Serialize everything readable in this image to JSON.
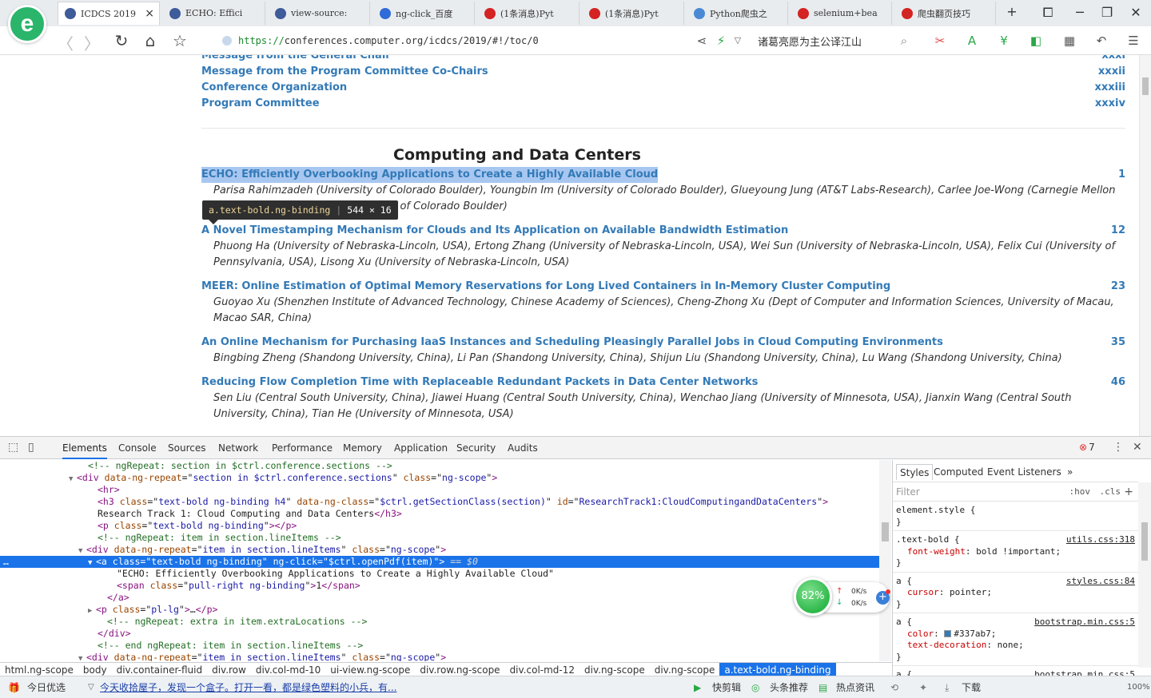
{
  "browser": {
    "tabs": [
      {
        "label": "ICDCS 2019",
        "icon_color": "#3e5b9a",
        "active": true
      },
      {
        "label": "ECHO: Effici",
        "icon_color": "#3e5b9a",
        "active": false
      },
      {
        "label": "view-source:",
        "icon_color": "#3e5b9a",
        "active": false
      },
      {
        "label": "ng-click_百度",
        "icon_color": "#2f6bd8",
        "active": false
      },
      {
        "label": "(1条消息)Pyt",
        "icon_color": "#d42323",
        "active": false
      },
      {
        "label": "(1条消息)Pyt",
        "icon_color": "#d42323",
        "active": false
      },
      {
        "label": "Python爬虫之",
        "icon_color": "#4a8ad4",
        "active": false
      },
      {
        "label": "selenium+bea",
        "icon_color": "#d42323",
        "active": false
      },
      {
        "label": "爬虫翻页技巧",
        "icon_color": "#d42323",
        "active": false
      }
    ],
    "tab_close_glyph": "×",
    "new_tab_glyph": "+",
    "url_scheme": "https://",
    "url_rest": "conferences.computer.org/icdcs/2019/#!/toc/0",
    "search_text": "诸葛亮愿为主公译江山",
    "logo_letter": "e"
  },
  "page": {
    "front_matter": [
      {
        "title": "Message from the General Chair",
        "page": "xxxi"
      },
      {
        "title": "Message from the Program Committee Co-Chairs",
        "page": "xxxii"
      },
      {
        "title": "Conference Organization",
        "page": "xxxiii"
      },
      {
        "title": "Program Committee",
        "page": "xxxiv"
      }
    ],
    "section_title": "Computing and Data Centers",
    "tooltip_class": "a.text-bold.ng-binding",
    "tooltip_size": "544 × 16",
    "papers": [
      {
        "title": "ECHO: Efficiently Overbooking Applications to Create a Highly Available Cloud",
        "page": "1",
        "authors": "Parisa Rahimzadeh (University of Colorado Boulder), Youngbin Im (University of Colorado Boulder), Glueyoung Jung (AT&T Labs-Research), Carlee Joe-Wong (Carnegie Mellon University), Sangtae Ha (University of Colorado Boulder)"
      },
      {
        "title": "A Novel Timestamping Mechanism for Clouds and Its Application on Available Bandwidth Estimation",
        "page": "12",
        "authors": "Phuong Ha (University of Nebraska-Lincoln, USA), Ertong Zhang (University of Nebraska-Lincoln, USA), Wei Sun (University of Nebraska-Lincoln, USA), Felix Cui (University of Pennsylvania, USA), Lisong Xu (University of Nebraska-Lincoln, USA)"
      },
      {
        "title": "MEER: Online Estimation of Optimal Memory Reservations for Long Lived Containers in In-Memory Cluster Computing",
        "page": "23",
        "authors": "Guoyao Xu (Shenzhen Institute of Advanced Technology, Chinese Academy of Sciences), Cheng-Zhong Xu (Dept of Computer and Information Sciences, University of Macau, Macao SAR, China)"
      },
      {
        "title": "An Online Mechanism for Purchasing IaaS Instances and Scheduling Pleasingly Parallel Jobs in Cloud Computing Environments",
        "page": "35",
        "authors": "Bingbing Zheng (Shandong University, China), Li Pan (Shandong University, China), Shijun Liu (Shandong University, China), Lu Wang (Shandong University, China)"
      },
      {
        "title": "Reducing Flow Completion Time with Replaceable Redundant Packets in Data Center Networks",
        "page": "46",
        "authors": "Sen Liu (Central South University, China), Jiawei Huang (Central South University, China), Wenchao Jiang (University of Minnesota, USA), Jianxin Wang (Central South University, China), Tian He (University of Minnesota, USA)"
      }
    ]
  },
  "devtools": {
    "tabs": [
      "Elements",
      "Console",
      "Sources",
      "Network",
      "Performance",
      "Memory",
      "Application",
      "Security",
      "Audits"
    ],
    "error_count": "7",
    "dom_lines": [
      {
        "indent": 110,
        "html": "<span class='cm'>&lt;!-- ngRepeat: section in $ctrl.conference.sections --&gt;</span>"
      },
      {
        "indent": 98,
        "tri": "▼",
        "html": "<span class='tg'>&lt;div</span> <span class='at'>data-ng-repeat</span>=\"<span class='av'>section in $ctrl.conference.sections</span>\" <span class='at'>class</span>=\"<span class='av'>ng-scope</span>\"<span class='tg'>&gt;</span>"
      },
      {
        "indent": 122,
        "html": "<span class='tg'>&lt;hr&gt;</span>"
      },
      {
        "indent": 122,
        "html": "<span class='tg'>&lt;h3</span> <span class='at'>class</span>=\"<span class='av'>text-bold ng-binding h4</span>\" <span class='at'>data-ng-class</span>=\"<span class='av'>$ctrl.getSectionClass(section)</span>\" <span class='at'>id</span>=\"<span class='av'>ResearchTrack1:CloudComputingandDataCenters</span>\"<span class='tg'>&gt;</span>"
      },
      {
        "indent": 122,
        "html": "Research Track 1: Cloud Computing and Data Centers<span class='tg'>&lt;/h3&gt;</span>"
      },
      {
        "indent": 122,
        "html": "<span class='tg'>&lt;p</span> <span class='at'>class</span>=\"<span class='av'>text-bold ng-binding</span>\"<span class='tg'>&gt;&lt;/p&gt;</span>"
      },
      {
        "indent": 122,
        "html": "<span class='cm'>&lt;!-- ngRepeat: item in section.lineItems --&gt;</span>"
      },
      {
        "indent": 110,
        "tri": "▼",
        "html": "<span class='tg'>&lt;div</span> <span class='at'>data-ng-repeat</span>=\"<span class='av'>item in section.lineItems</span>\" <span class='at'>class</span>=\"<span class='av'>ng-scope</span>\"<span class='tg'>&gt;</span>"
      },
      {
        "indent": 122,
        "tri": "▼",
        "sel": true,
        "html": "<span class='tg'>&lt;a</span> <span class='at'>class</span>=\"<span class='av'>text-bold ng-binding</span>\" <span class='at'>ng-click</span>=\"<span class='av'>$ctrl.openPdf(item)</span>\"<span class='tg'>&gt;</span> <span class='eq'>== $0</span>"
      },
      {
        "indent": 146,
        "html": "\"ECHO: Efficiently Overbooking Applications to Create a Highly Available Cloud\""
      },
      {
        "indent": 146,
        "html": "<span class='tg'>&lt;span</span> <span class='at'>class</span>=\"<span class='av'>pull-right ng-binding</span>\"<span class='tg'>&gt;</span>1<span class='tg'>&lt;/span&gt;</span>"
      },
      {
        "indent": 134,
        "html": "<span class='tg'>&lt;/a&gt;</span>"
      },
      {
        "indent": 122,
        "tri": "▶",
        "html": "<span class='tg'>&lt;p</span> <span class='at'>class</span>=\"<span class='av'>pl-lg</span>\"<span class='tg'>&gt;</span>…<span class='tg'>&lt;/p&gt;</span>"
      },
      {
        "indent": 134,
        "html": "<span class='cm'>&lt;!-- ngRepeat: extra in item.extraLocations --&gt;</span>"
      },
      {
        "indent": 122,
        "html": "<span class='tg'>&lt;/div&gt;</span>"
      },
      {
        "indent": 122,
        "html": "<span class='cm'>&lt;!-- end ngRepeat: item in section.lineItems --&gt;</span>"
      },
      {
        "indent": 110,
        "tri": "▼",
        "html": "<span class='tg'>&lt;div</span> <span class='at'>data-ng-repeat</span>=\"<span class='av'>item in section.lineItems</span>\" <span class='at'>class</span>=\"<span class='av'>ng-scope</span>\"<span class='tg'>&gt;</span>"
      }
    ],
    "styles_tabs": [
      "Styles",
      "Computed",
      "Event Listeners"
    ],
    "filter_placeholder": "Filter",
    "hov_label": ":hov",
    "cls_label": ".cls",
    "rules": [
      {
        "selector": "element.style {",
        "source": "",
        "props": []
      },
      {
        "selector": ".text-bold {",
        "source": "utils.css:318",
        "props": [
          {
            "name": "font-weight",
            "value": "bold !important;"
          }
        ]
      },
      {
        "selector": "a {",
        "source": "styles.css:84",
        "props": [
          {
            "name": "cursor",
            "value": "pointer;"
          }
        ]
      },
      {
        "selector": "a {",
        "source": "bootstrap.min.css:5",
        "props": [
          {
            "name": "color",
            "value": "#337ab7;",
            "swatch": true
          },
          {
            "name": "text-decoration",
            "value": "none;"
          }
        ]
      },
      {
        "selector": "a {",
        "source": "bootstrap.min.css:5",
        "props": []
      }
    ],
    "breadcrumbs": [
      "html.ng-scope",
      "body",
      "div.container-fluid",
      "div.row",
      "div.col-md-10",
      "ui-view.ng-scope",
      "div.row.ng-scope",
      "div.col-md-12",
      "div.ng-scope",
      "div.ng-scope",
      "a.text-bold.ng-binding"
    ]
  },
  "net_widget": {
    "percent": "82%",
    "up": "0K/s",
    "down": "0K/s"
  },
  "statusbar": {
    "daily_pick": "今日优选",
    "news": "今天收拾屋子，发现一个盒子。打开一看，都是绿色塑料的小兵，有...",
    "clip": "快剪辑",
    "headline": "头条推荐",
    "hot": "热点资讯",
    "download": "下载",
    "zoom": "100%"
  }
}
